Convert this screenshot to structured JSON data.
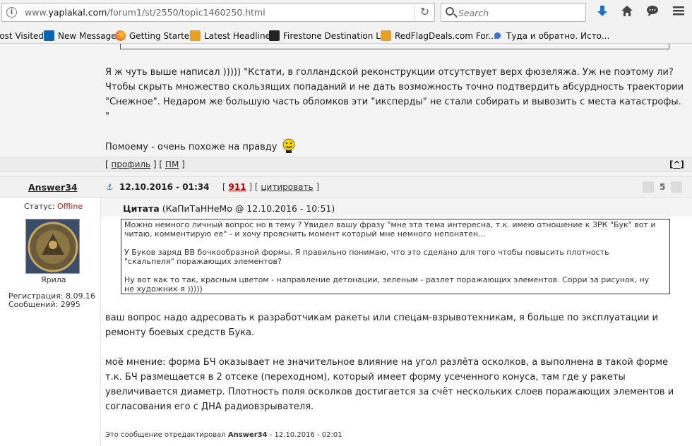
{
  "browser": {
    "url_prefix": "www.",
    "url_domain": "yaplakal.com",
    "url_path": "/forum1/st/2550/topic1460250.html",
    "search_placeholder": "Search",
    "bookmarks": [
      {
        "label": "lost Visited",
        "icon": "none"
      },
      {
        "label": "New Message",
        "icon": "outlook-icon"
      },
      {
        "label": "Getting Started",
        "icon": "firefox-icon"
      },
      {
        "label": "Latest Headlines",
        "icon": "rss-icon"
      },
      {
        "label": "Firestone Destination L...",
        "icon": "firestone-icon"
      },
      {
        "label": "RedFlagDeals.com For...",
        "icon": "rss-icon"
      },
      {
        "label": "Туда и обратно. Исто...",
        "icon": "pin-icon"
      }
    ]
  },
  "post1": {
    "lines": [
      "Я ж чуть выше написал ))))) \"Кстати, в голландской реконструкции отсутствует верх фюзеляжа. Уж не поэтому ли?",
      "Чтобы скрыть множество скользящих попаданий и не дать возможность точно подтвердить абсурдность траектории",
      "\"Снежное\". Недаром же большую часть обломков эти \"иксперды\" не стали собирать и вывозить с места катастрофы.",
      "\""
    ],
    "closing": "Помоему - очень похоже на правду",
    "profile_link": "профиль",
    "pm_link": "ПМ",
    "top_link": "^"
  },
  "post2": {
    "author": "Answer34",
    "datetime": "12.10.2016 - 01:34",
    "post_number": "911",
    "quote_link": "цитировать",
    "rating": "5",
    "status_label": "Статус:",
    "status_value": "Offline",
    "avatar_caption": "Ярила",
    "registration": "Регистрация: 8.09.16",
    "messages": "Сообщений: 2995",
    "quote_title": "Цитата",
    "quote_meta": "(КаПиТаННеМо @ 12.10.2016 - 10:51)",
    "quote_lines": [
      "Можно немного личный вопрос но в тему ? Увидел вашу фразу \"мне эта тема интересна, т.к. имею отношение к ЗРК \"Бук\" вот и",
      "читаю, комментирую ее\" - и хочу прояснить момент который мне немного непонятен...",
      "",
      "У Буков заряд ВВ бочкообразной формы. Я правильно понимаю, что это сделано для того чтобы повысить плотность",
      "\"скальпеля\" поражающих элементов?",
      "",
      "Ну вот как то так, красным цветом - направление детонации, зеленым - разлет поражающих элементов. Сорри за рисунок, ну",
      "не художник я )))))"
    ],
    "body_lines": [
      "ваш вопрос надо адресовать к разработчикам ракеты или спецам-взрывотехникам, я больше по эксплуатации и",
      "ремонту боевых средств Бука.",
      "",
      "моё мнение: форма БЧ оказывает не значительное влияние на угол разлёта осколков, а выполнена в такой форме",
      "т.к. БЧ размещается в 2 отсеке (переходном), который имеет форму усеченного конуса, там где у ракеты",
      "увеличивается диаметр. Плотность поля осколков достигается за счёт нескольких слоев поражающих элементов и",
      "согласования его с ДНА радиовзрывателя."
    ],
    "edited_prefix": "Это сообщение отредактировал",
    "edited_author": "Answer34",
    "edited_date": "- 12.10.2016 - 02:01"
  },
  "colors": {
    "offline": "#b22222",
    "post_number": "#c00000",
    "chrome_bg": "#f2f2f2",
    "download_arrow": "#1f6fc2"
  }
}
